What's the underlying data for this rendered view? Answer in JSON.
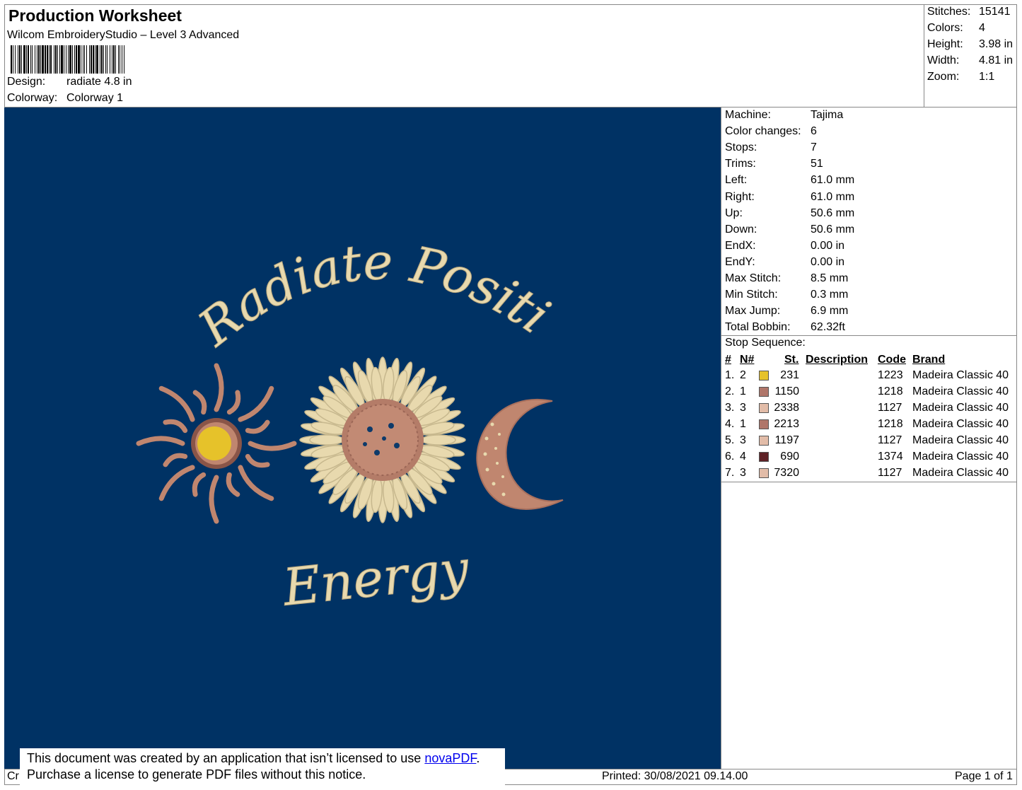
{
  "header": {
    "title": "Production Worksheet",
    "subtitle": "Wilcom EmbroideryStudio – Level 3 Advanced",
    "design_label": "Design:",
    "design_value": "radiate 4.8 in",
    "colorway_label": "Colorway:",
    "colorway_value": "Colorway 1"
  },
  "stats": [
    {
      "label": "Stitches:",
      "value": "15141"
    },
    {
      "label": "Colors:",
      "value": "4"
    },
    {
      "label": "Height:",
      "value": "3.98 in"
    },
    {
      "label": "Width:",
      "value": "4.81 in"
    },
    {
      "label": "Zoom:",
      "value": "1:1"
    }
  ],
  "design": {
    "background": "#003264",
    "text_top": "Radiate Positive",
    "text_bottom": "Energy",
    "thread_cream": "#e8d9ae",
    "thread_tan": "#c0866f",
    "thread_gold": "#e6c22a"
  },
  "info": [
    {
      "label": "Machine:",
      "value": "Tajima"
    },
    {
      "label": "Color changes:",
      "value": "6"
    },
    {
      "label": "Stops:",
      "value": "7"
    },
    {
      "label": "Trims:",
      "value": "51"
    },
    {
      "label": "Left:",
      "value": "61.0 mm"
    },
    {
      "label": "Right:",
      "value": "61.0 mm"
    },
    {
      "label": "Up:",
      "value": "50.6 mm"
    },
    {
      "label": "Down:",
      "value": "50.6 mm"
    },
    {
      "label": "EndX:",
      "value": "0.00 in"
    },
    {
      "label": "EndY:",
      "value": "0.00 in"
    },
    {
      "label": "Max Stitch:",
      "value": "8.5 mm"
    },
    {
      "label": "Min Stitch:",
      "value": "0.3 mm"
    },
    {
      "label": "Max Jump:",
      "value": "6.9 mm"
    },
    {
      "label": "Total Bobbin:",
      "value": "62.32ft"
    }
  ],
  "stop_sequence": {
    "label": "Stop Sequence:",
    "columns": {
      "num": "#",
      "n": "N#",
      "st": "St.",
      "description": "Description",
      "code": "Code",
      "brand": "Brand"
    },
    "rows": [
      {
        "num": "1.",
        "n": "2",
        "color": "#e6c22a",
        "st": "231",
        "code": "1223",
        "brand": "Madeira Classic 40"
      },
      {
        "num": "2.",
        "n": "1",
        "color": "#b0766a",
        "st": "1150",
        "code": "1218",
        "brand": "Madeira Classic 40"
      },
      {
        "num": "3.",
        "n": "3",
        "color": "#e2bca8",
        "st": "2338",
        "code": "1127",
        "brand": "Madeira Classic 40"
      },
      {
        "num": "4.",
        "n": "1",
        "color": "#b0766a",
        "st": "2213",
        "code": "1218",
        "brand": "Madeira Classic 40"
      },
      {
        "num": "5.",
        "n": "3",
        "color": "#e2bca8",
        "st": "1197",
        "code": "1127",
        "brand": "Madeira Classic 40"
      },
      {
        "num": "6.",
        "n": "4",
        "color": "#5e2126",
        "st": "690",
        "code": "1374",
        "brand": "Madeira Classic 40"
      },
      {
        "num": "7.",
        "n": "3",
        "color": "#e2bca8",
        "st": "7320",
        "code": "1127",
        "brand": "Madeira Classic 40"
      }
    ]
  },
  "footer": {
    "left_fragment": "Cr",
    "printed": "Printed: 30/08/2021 09.14.00",
    "page": "Page 1 of 1",
    "notice_line1_pre": "This document was created by an application that isn’t licensed to use ",
    "notice_link": "novaPDF",
    "notice_line1_post": ".",
    "notice_line2": "Purchase a license to generate PDF files without this notice."
  }
}
